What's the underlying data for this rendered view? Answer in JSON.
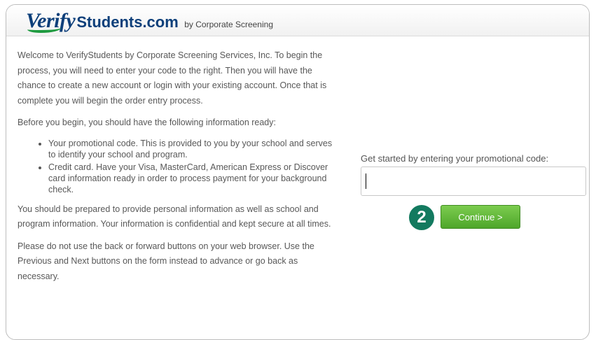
{
  "header": {
    "logo_verify": "Verify",
    "logo_students": "Students.com",
    "logo_by": "by Corporate Screening"
  },
  "intro": {
    "p1": "Welcome to VerifyStudents by Corporate Screening Services, Inc. To begin the process, you will need to enter your code to the right. Then you will have the chance to create a new account or login with your existing account. Once that is complete you will begin the order entry process.",
    "p2": "Before you begin, you should have the following information ready:",
    "bullets": [
      "Your promotional code. This is provided to you by your school and serves to identify your school and program.",
      "Credit card. Have your Visa, MasterCard, American Express or Discover card information ready in order to process payment for your background check."
    ],
    "p3": "You should be prepared to provide personal information as well as school and program information. Your information is confidential and kept secure at all times.",
    "p4": "Please do not use the back or forward buttons on your web browser. Use the Previous and Next buttons on the form instead to advance or go back as necessary."
  },
  "promo": {
    "label": "Get started by entering your promotional code:",
    "value": "",
    "continue_label": "Continue >",
    "step_number": "2"
  },
  "colors": {
    "brand_blue": "#0d3f7a",
    "brand_green": "#1e9a3f",
    "button_green": "#5db536",
    "badge_teal": "#137a5f"
  }
}
